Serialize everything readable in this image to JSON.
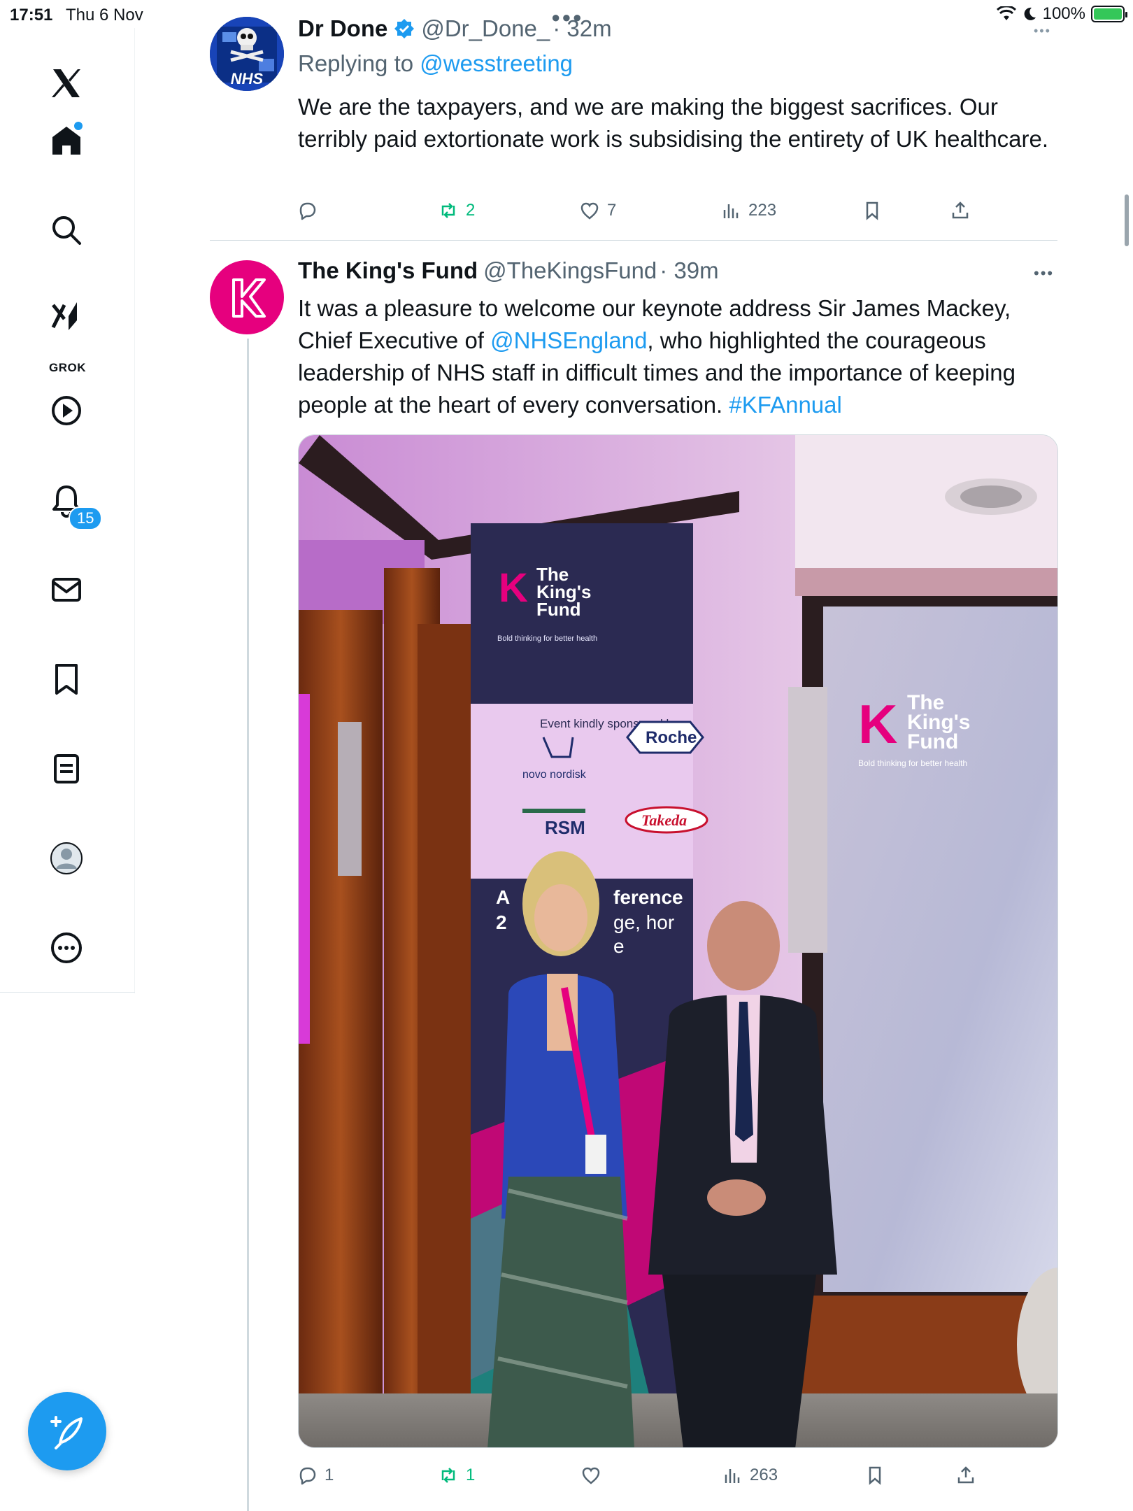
{
  "status_bar": {
    "time": "17:51",
    "date": "Thu 6 Nov",
    "battery": "100%",
    "battery_level": 1.0
  },
  "sidebar": {
    "items": [
      {
        "name": "x-logo",
        "label": ""
      },
      {
        "name": "home",
        "label": ""
      },
      {
        "name": "search",
        "label": ""
      },
      {
        "name": "grok",
        "label": "GROK"
      },
      {
        "name": "video",
        "label": ""
      },
      {
        "name": "notifications",
        "label": ""
      },
      {
        "name": "messages",
        "label": ""
      },
      {
        "name": "bookmarks",
        "label": ""
      },
      {
        "name": "lists",
        "label": ""
      },
      {
        "name": "profile",
        "label": ""
      },
      {
        "name": "more",
        "label": ""
      }
    ],
    "notification_count": "15"
  },
  "tweets": [
    {
      "author": "Dr Done",
      "verified": true,
      "handle": "@Dr_Done_",
      "time": "· 32m",
      "replying_prefix": "Replying to ",
      "replying_to": "@wesstreeting",
      "text": "We are the taxpayers, and we are making the biggest sacrifices. Our terribly paid extortionate work is subsidising the entirety of UK healthcare.",
      "avatar_text": "NHS",
      "stats": {
        "replies": "",
        "reposts": "2",
        "likes": "7",
        "views": "223"
      }
    },
    {
      "author": "The King's Fund",
      "handle": "@TheKingsFund",
      "time": "· 39m",
      "text_part1": "It was a pleasure to welcome our keynote address Sir James Mackey, Chief Executive of ",
      "mention": "@NHSEngland",
      "text_part2": ", who highlighted the courageous leadership of NHS staff in difficult times and the importance of keeping people at the heart of every conversation. ",
      "hashtag": "#KFAnnual",
      "stats": {
        "replies": "1",
        "reposts": "1",
        "likes": "",
        "views": "263"
      },
      "image": {
        "banner_brand_line1": "The",
        "banner_brand_line2": "King's",
        "banner_brand_line3": "Fund",
        "banner_tagline": "Bold thinking for better health",
        "sponsor_title": "Event kindly sponsored by",
        "sponsors": [
          "novo nordisk",
          "Roche",
          "RSM",
          "Takeda"
        ],
        "partial_banner_line1": "A",
        "partial_banner_line1b": "ference",
        "partial_banner_line2": "2",
        "partial_banner_line2b": "ge, hor",
        "partial_banner_line3": "e",
        "screen_brand_line1": "The",
        "screen_brand_line2": "King's",
        "screen_brand_line3": "Fund",
        "screen_tagline": "Bold thinking for better health"
      }
    }
  ],
  "colors": {
    "accent": "#1d9bf0",
    "repost_green": "#00ba7c",
    "kingsfund_magenta": "#e6007e"
  }
}
